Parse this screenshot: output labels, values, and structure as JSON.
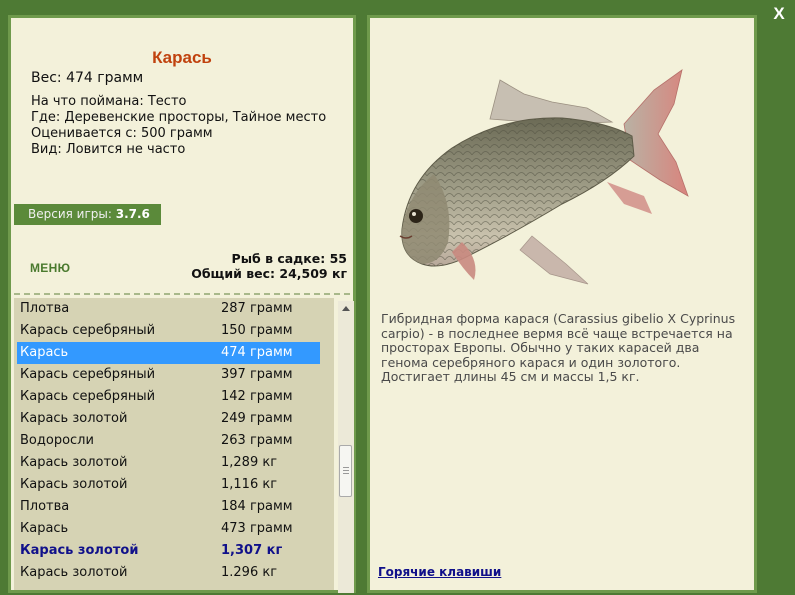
{
  "fish": {
    "name": "Карась",
    "weight_line": "Вес: 474 грамм",
    "caught_on": "На что поймана: Тесто",
    "location": "Где: Деревенские просторы, Тайное место",
    "valued_from": "Оценивается с: 500 грамм",
    "rarity": "Вид: Ловится не часто",
    "description": "Гибридная форма карася (Carassius gibelio X Cyprinus carpio) - в последнее вермя всё чаще встречается на просторах Европы. Обычно у таких карасей два генома серебряного карася и один золотого. Достигает длины 45 см и массы 1,5 кг."
  },
  "version": {
    "label": "Версия игры:",
    "value": "3.7.6"
  },
  "menu": {
    "label": "МЕНЮ"
  },
  "stats": {
    "fish_count": "Рыб в садке: 55",
    "total_weight": "Общий вес: 24,509 кг"
  },
  "catch_list": [
    {
      "name": "Плотва",
      "weight": "287 грамм"
    },
    {
      "name": "Карась серебряный",
      "weight": "150 грамм"
    },
    {
      "name": "Карась",
      "weight": "474 грамм",
      "selected": true
    },
    {
      "name": "Карась серебряный",
      "weight": "397 грамм"
    },
    {
      "name": "Карась серебряный",
      "weight": "142 грамм"
    },
    {
      "name": "Карась золотой",
      "weight": "249 грамм"
    },
    {
      "name": "Водоросли",
      "weight": "263 грамм"
    },
    {
      "name": "Карась золотой",
      "weight": "1,289 кг"
    },
    {
      "name": "Карась золотой",
      "weight": "1,116 кг"
    },
    {
      "name": "Плотва",
      "weight": "184 грамм"
    },
    {
      "name": "Карась",
      "weight": "473 грамм"
    },
    {
      "name": "Карась золотой",
      "weight": "1,307 кг",
      "bold": true
    },
    {
      "name": "Карась золотой",
      "weight": "1.296 кг"
    }
  ],
  "hotkeys": {
    "label": "Горячие клавиши"
  },
  "close": {
    "label": "X"
  },
  "colors": {
    "background": "#4e7a34",
    "panel": "#f3f1da",
    "title": "#c0420e",
    "selection": "#3399ff",
    "link": "#10108a"
  },
  "icons": {
    "close": "close-icon",
    "scroll_up": "scroll-up-arrow-icon"
  }
}
